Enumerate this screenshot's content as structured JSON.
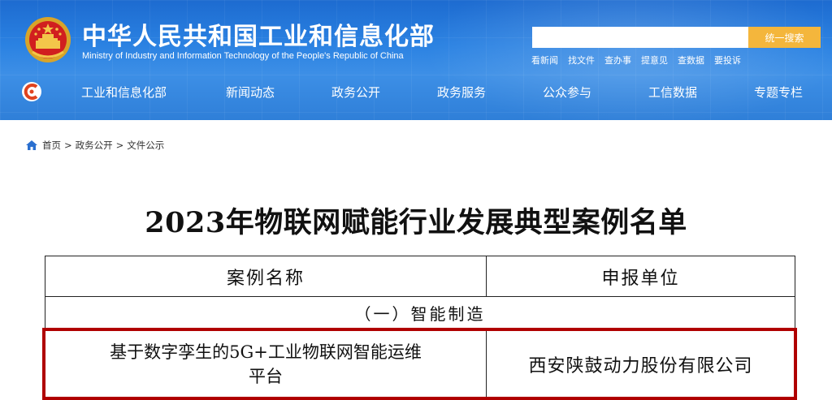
{
  "header": {
    "title": "中华人民共和国工业和信息化部",
    "subtitle": "Ministry of Industry and Information Technology of the People's Republic of China",
    "search": {
      "placeholder": "",
      "button_label": "统一搜索"
    },
    "quick_links": [
      "看新闻",
      "找文件",
      "查办事",
      "提意见",
      "查数据",
      "要投诉"
    ]
  },
  "nav": {
    "items": [
      "工业和信息化部",
      "新闻动态",
      "政务公开",
      "政务服务",
      "公众参与",
      "工信数据",
      "专题专栏"
    ]
  },
  "breadcrumb": {
    "items": [
      "首页",
      "政务公开",
      "文件公示"
    ],
    "separator": ">"
  },
  "document": {
    "title": "2023年物联网赋能行业发展典型案例名单",
    "table": {
      "headers": [
        "案例名称",
        "申报单位"
      ],
      "section": "（一）智能制造",
      "rows": [
        {
          "case_name_line1": "基于数字孪生的5G+工业物联网智能运维",
          "case_name_line2": "平台",
          "unit": "西安陕鼓动力股份有限公司"
        }
      ]
    }
  },
  "colors": {
    "header_blue": "#2b82e2",
    "search_button": "#f4b63c",
    "highlight_border": "#b00000"
  }
}
